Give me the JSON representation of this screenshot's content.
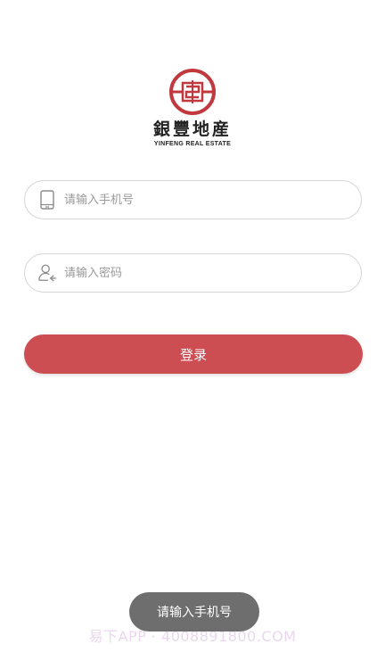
{
  "logo": {
    "cn_name": "銀豐地産",
    "en_name": "YINFENG REAL ESTATE",
    "brand_color": "#c0393e"
  },
  "phone_field": {
    "placeholder": "请输入手机号",
    "value": "",
    "icon": "smartphone-icon"
  },
  "password_field": {
    "placeholder": "请输入密码",
    "value": "",
    "icon": "user-key-icon"
  },
  "login_button": {
    "label": "登录",
    "color": "#cd4e52"
  },
  "toast": {
    "message": "请输入手机号"
  },
  "watermark": {
    "text": "易下APP · 4008891800.COM"
  }
}
